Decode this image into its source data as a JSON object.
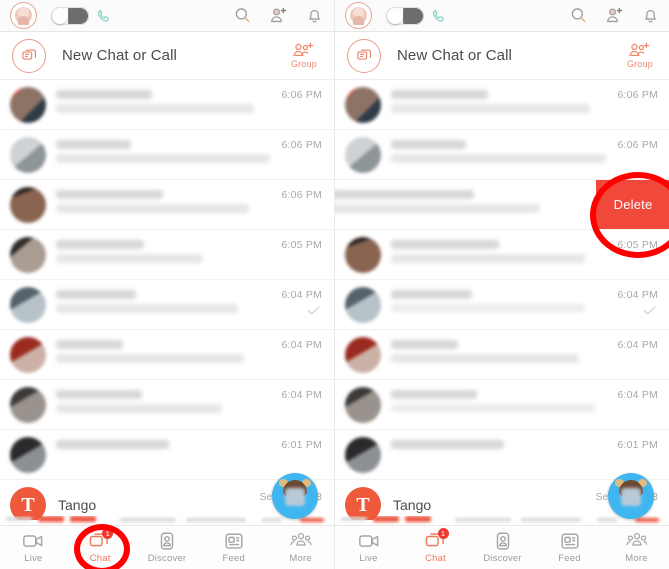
{
  "app": {
    "name": "Tango",
    "accent_color": "#ef7a57",
    "delete_color": "#f0493c",
    "annotation_color": "#ff0000",
    "badge_color": "#ef3b2f"
  },
  "topbar": {
    "profile_avatar": "profile-avatar",
    "toggle_state": "off",
    "phone_icon": "phone-icon",
    "search_icon": "search-icon",
    "add_contact_icon": "add-contact-icon",
    "notification_icon": "bell-icon"
  },
  "newchat": {
    "icon": "new-chat-icon",
    "label": "New Chat or Call",
    "group_icon": "group-add-icon",
    "group_label": "Group"
  },
  "list": {
    "rows": [
      {
        "time": "6:06 PM",
        "avatar_color": "#9b8b80",
        "blurred": true,
        "lines": 2,
        "tick": false
      },
      {
        "time": "6:06 PM",
        "avatar_color": "#b9bcbe",
        "blurred": true,
        "lines": 2,
        "tick": false
      },
      {
        "time": "6:06 PM",
        "avatar_color": "#7d5b47",
        "blurred": true,
        "lines": 2,
        "tick": false
      },
      {
        "time": "6:05 PM",
        "avatar_color": "#8c8c8c",
        "blurred": true,
        "lines": 2,
        "tick": false
      },
      {
        "time": "6:04 PM",
        "avatar_color": "#7e8a93",
        "blurred": true,
        "lines": 2,
        "tick": true
      },
      {
        "time": "6:04 PM",
        "avatar_color": "#8e2d24",
        "blurred": true,
        "lines": 2,
        "tick": false
      },
      {
        "time": "6:04 PM",
        "avatar_color": "#6e6a66",
        "blurred": true,
        "lines": 2,
        "tick": false
      },
      {
        "time": "6:01 PM",
        "avatar_color": "#55585a",
        "blurred": true,
        "lines": 1,
        "tick": false
      }
    ],
    "tango_row": {
      "name": "Tango",
      "avatar_letter": "T",
      "date": "Sep 18, 2018"
    },
    "swipe_row_index": 2,
    "delete_label": "Delete"
  },
  "tabs": [
    {
      "label": "Live",
      "icon": "video-camera-icon",
      "active": false,
      "badge": null
    },
    {
      "label": "Chat",
      "icon": "chat-bubbles-icon",
      "active": true,
      "badge": "1"
    },
    {
      "label": "Discover",
      "icon": "person-card-icon",
      "active": false,
      "badge": null
    },
    {
      "label": "Feed",
      "icon": "feed-icon",
      "active": false,
      "badge": null
    },
    {
      "label": "More",
      "icon": "people-group-icon",
      "active": false,
      "badge": null
    }
  ],
  "annotations": [
    {
      "name": "chat-tab-highlight",
      "panel": "left",
      "shape": "circle"
    },
    {
      "name": "delete-button-highlight",
      "panel": "right",
      "shape": "circle"
    }
  ]
}
